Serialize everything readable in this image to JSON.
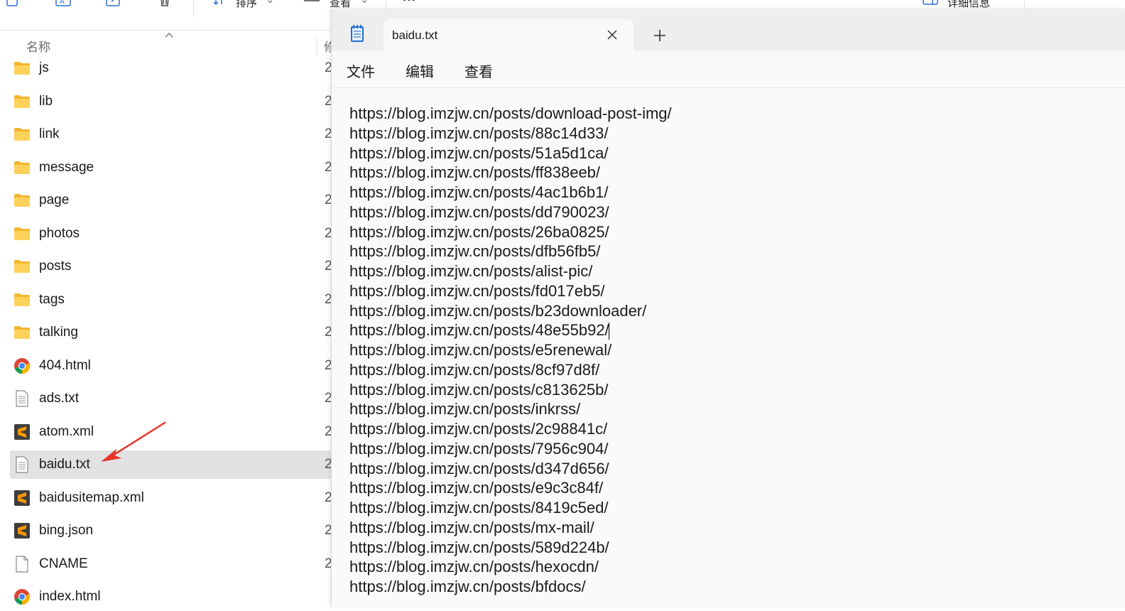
{
  "explorer": {
    "toolbar": {
      "sort_label": "排序",
      "view_label": "查看",
      "more_label": "•••",
      "details_label": "详细信息"
    },
    "columns": {
      "name": "名称",
      "modified": "修"
    },
    "files": [
      {
        "name": "js",
        "type": "folder",
        "date": "2"
      },
      {
        "name": "lib",
        "type": "folder",
        "date": "2"
      },
      {
        "name": "link",
        "type": "folder",
        "date": "2"
      },
      {
        "name": "message",
        "type": "folder",
        "date": "2"
      },
      {
        "name": "page",
        "type": "folder",
        "date": "2"
      },
      {
        "name": "photos",
        "type": "folder",
        "date": "2"
      },
      {
        "name": "posts",
        "type": "folder",
        "date": "2"
      },
      {
        "name": "tags",
        "type": "folder",
        "date": "2"
      },
      {
        "name": "talking",
        "type": "folder",
        "date": "2"
      },
      {
        "name": "404.html",
        "type": "chrome",
        "date": "2"
      },
      {
        "name": "ads.txt",
        "type": "text",
        "date": "2"
      },
      {
        "name": "atom.xml",
        "type": "sublime",
        "date": "2"
      },
      {
        "name": "baidu.txt",
        "type": "text",
        "date": "2",
        "selected": true
      },
      {
        "name": "baidusitemap.xml",
        "type": "sublime",
        "date": "2"
      },
      {
        "name": "bing.json",
        "type": "sublime",
        "date": "2"
      },
      {
        "name": "CNAME",
        "type": "blank",
        "date": "2"
      },
      {
        "name": "index.html",
        "type": "chrome",
        "date": ""
      }
    ],
    "accent_colors": {
      "folder": "#f8c63d",
      "selection": "#e2e2e2",
      "arrow": "#e8332b"
    }
  },
  "notepad": {
    "tab_title": "baidu.txt",
    "menu": [
      "文件",
      "编辑",
      "查看"
    ],
    "lines": [
      "https://blog.imzjw.cn/posts/download-post-img/",
      "https://blog.imzjw.cn/posts/88c14d33/",
      "https://blog.imzjw.cn/posts/51a5d1ca/",
      "https://blog.imzjw.cn/posts/ff838eeb/",
      "https://blog.imzjw.cn/posts/4ac1b6b1/",
      "https://blog.imzjw.cn/posts/dd790023/",
      "https://blog.imzjw.cn/posts/26ba0825/",
      "https://blog.imzjw.cn/posts/dfb56fb5/",
      "https://blog.imzjw.cn/posts/alist-pic/",
      "https://blog.imzjw.cn/posts/fd017eb5/",
      "https://blog.imzjw.cn/posts/b23downloader/",
      "https://blog.imzjw.cn/posts/48e55b92/",
      "https://blog.imzjw.cn/posts/e5renewal/",
      "https://blog.imzjw.cn/posts/8cf97d8f/",
      "https://blog.imzjw.cn/posts/c813625b/",
      "https://blog.imzjw.cn/posts/inkrss/",
      "https://blog.imzjw.cn/posts/2c98841c/",
      "https://blog.imzjw.cn/posts/7956c904/",
      "https://blog.imzjw.cn/posts/d347d656/",
      "https://blog.imzjw.cn/posts/e9c3c84f/",
      "https://blog.imzjw.cn/posts/8419c5ed/",
      "https://blog.imzjw.cn/posts/mx-mail/",
      "https://blog.imzjw.cn/posts/589d224b/",
      "https://blog.imzjw.cn/posts/hexocdn/",
      "https://blog.imzjw.cn/posts/bfdocs/"
    ],
    "caret_line": 12
  }
}
